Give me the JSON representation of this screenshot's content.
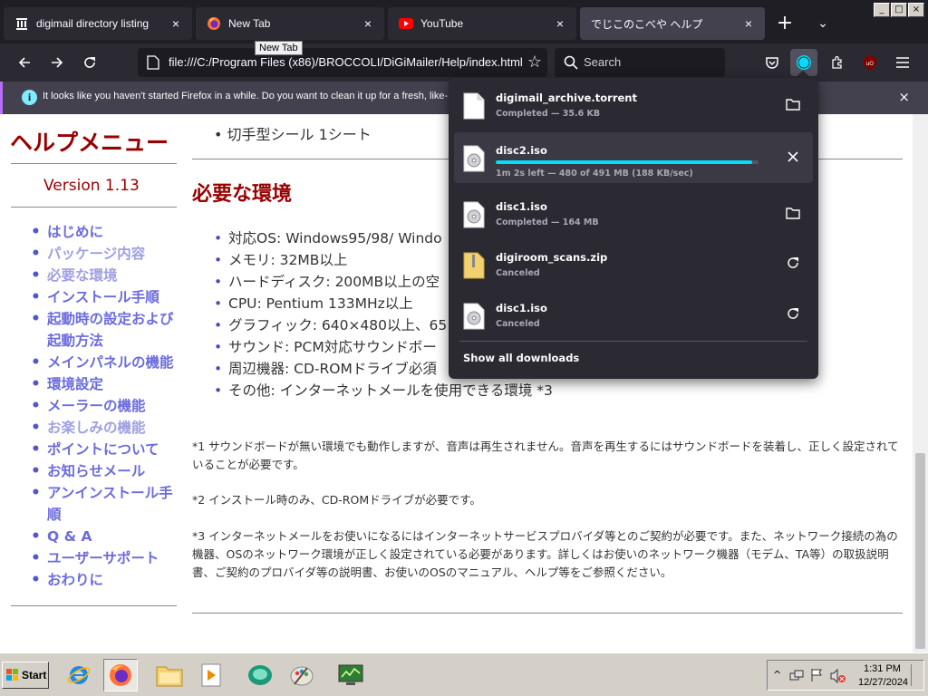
{
  "window": {
    "minimize": "_",
    "maximize": "□",
    "close": "×"
  },
  "tabs": [
    {
      "label": "digimail directory listing",
      "icon": "library-icon"
    },
    {
      "label": "New Tab",
      "icon": "firefox-icon"
    },
    {
      "label": "YouTube",
      "icon": "youtube-icon"
    },
    {
      "label": "でじこのこべや ヘルプ",
      "icon": "none"
    }
  ],
  "tab_close": "×",
  "tab_new": "+",
  "tab_list": "⌄",
  "tooltip": "New Tab",
  "nav": {
    "url": "file:///C:/Program Files (x86)/BROCCOLI/DiGiMailer/Help/index.html",
    "search_placeholder": "Search"
  },
  "notification": {
    "text": "It looks like you haven't started Firefox in a while. Do you want to clean it up for a fresh, like-",
    "info": "i",
    "close": "×"
  },
  "sidebar": {
    "title": "ヘルプメニュー",
    "version": "Version 1.13",
    "items": [
      {
        "label": "はじめに",
        "visited": false
      },
      {
        "label": "パッケージ内容",
        "visited": true
      },
      {
        "label": "必要な環境",
        "visited": true
      },
      {
        "label": "インストール手順",
        "visited": false
      },
      {
        "label": "起動時の設定および起動方法",
        "visited": false
      },
      {
        "label": "メインパネルの機能",
        "visited": false
      },
      {
        "label": "環境設定",
        "visited": false
      },
      {
        "label": "メーラーの機能",
        "visited": false
      },
      {
        "label": "お楽しみの機能",
        "visited": true
      },
      {
        "label": "ポイントについて",
        "visited": false
      },
      {
        "label": "お知らせメール",
        "visited": false
      },
      {
        "label": "アンインストール手順",
        "visited": false
      },
      {
        "label": "Q & A",
        "visited": false
      },
      {
        "label": "ユーザーサポート",
        "visited": false
      },
      {
        "label": "おわりに",
        "visited": false
      }
    ]
  },
  "main": {
    "top_item": "切手型シール 1シート",
    "heading": "必要な環境",
    "requirements": [
      "対応OS: Windows95/98/ Windo",
      "メモリ: 32MB以上",
      "ハードディスク: 200MB以上の空",
      "CPU: Pentium 133MHz以上",
      "グラフィック: 640×480以上、65",
      "サウンド: PCM対応サウンドボー",
      "周辺機器: CD-ROMドライブ必須",
      "その他: インターネットメールを使用できる環境 *3"
    ],
    "notes": [
      "*1 サウンドボードが無い環境でも動作しますが、音声は再生されません。音声を再生するにはサウンドボードを装着し、正しく設定されていることが必要です。",
      "*2 インストール時のみ、CD-ROMドライブが必要です。",
      "*3 インターネットメールをお使いになるにはインターネットサービスプロバイダ等とのご契約が必要です。また、ネットワーク接続の為の機器、OSのネットワーク環境が正しく設定されている必要があります。詳しくはお使いのネットワーク機器（モデム、TA等）の取扱説明書、ご契約のプロバイダ等の説明書、お使いのOSのマニュアル、ヘルプ等をご参照ください。"
    ]
  },
  "downloads": {
    "items": [
      {
        "name": "digimail_archive.torrent",
        "status": "Completed — 35.6 KB",
        "icon": "file-icon",
        "action": "folder-icon",
        "progress": null
      },
      {
        "name": "disc2.iso",
        "status": "1m 2s left — 480 of 491 MB (188 KB/sec)",
        "icon": "disc-icon",
        "action": "cancel-icon",
        "progress": 0.977
      },
      {
        "name": "disc1.iso",
        "status": "Completed — 164 MB",
        "icon": "disc-icon",
        "action": "folder-icon",
        "progress": null
      },
      {
        "name": "digiroom_scans.zip",
        "status": "Canceled",
        "icon": "zip-icon",
        "action": "retry-icon",
        "progress": null
      },
      {
        "name": "disc1.iso",
        "status": "Canceled",
        "icon": "disc-icon",
        "action": "retry-icon",
        "progress": null
      }
    ],
    "show_all": "Show all downloads"
  },
  "taskbar": {
    "start": "Start",
    "time": "1:31 PM",
    "date": "12/27/2024"
  },
  "colors": {
    "accent": "#00ddff",
    "heading": "#990000",
    "link": "#6b6bde",
    "visited": "#9f9fe4"
  }
}
